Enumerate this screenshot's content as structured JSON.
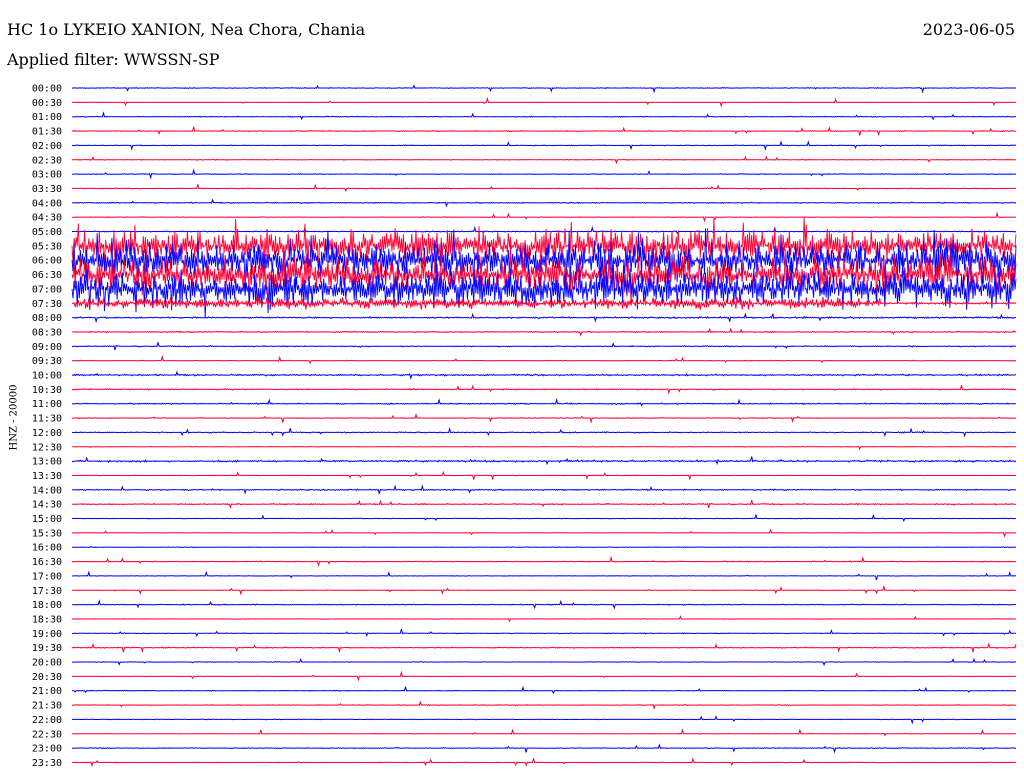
{
  "header": {
    "station": "HC 1o LYKEIO XANION, Nea Chora, Chania",
    "date": "2023-06-05",
    "filter": "Applied filter: WWSSN-SP"
  },
  "chart_data": {
    "type": "helicorder",
    "title": "HC 1o LYKEIO XANION, Nea Chora, Chania",
    "subtitle": "Applied filter: WWSSN-SP",
    "ylabel": "HNZ - 20000",
    "date": "2023-06-05",
    "colors": [
      "#0000ff",
      "#ff0033"
    ],
    "rows": [
      {
        "label": "00:00",
        "color": "#0000ff",
        "activity": 0.05
      },
      {
        "label": "00:30",
        "color": "#ff0033",
        "activity": 0.03
      },
      {
        "label": "01:00",
        "color": "#0000ff",
        "activity": 0.06
      },
      {
        "label": "01:30",
        "color": "#ff0033",
        "activity": 0.06
      },
      {
        "label": "02:00",
        "color": "#0000ff",
        "activity": 0.05
      },
      {
        "label": "02:30",
        "color": "#ff0033",
        "activity": 0.05
      },
      {
        "label": "03:00",
        "color": "#0000ff",
        "activity": 0.05
      },
      {
        "label": "03:30",
        "color": "#ff0033",
        "activity": 0.06
      },
      {
        "label": "04:00",
        "color": "#0000ff",
        "activity": 0.07
      },
      {
        "label": "04:30",
        "color": "#ff0033",
        "activity": 0.05
      },
      {
        "label": "05:00",
        "color": "#0000ff",
        "activity": 0.06
      },
      {
        "label": "05:30",
        "color": "#ff0033",
        "activity": 0.9
      },
      {
        "label": "06:00",
        "color": "#0000ff",
        "activity": 1.0
      },
      {
        "label": "06:30",
        "color": "#ff0033",
        "activity": 1.0
      },
      {
        "label": "07:00",
        "color": "#0000ff",
        "activity": 1.0
      },
      {
        "label": "07:30",
        "color": "#ff0033",
        "activity": 0.3
      },
      {
        "label": "08:00",
        "color": "#0000ff",
        "activity": 0.1
      },
      {
        "label": "08:30",
        "color": "#ff0033",
        "activity": 0.08
      },
      {
        "label": "09:00",
        "color": "#0000ff",
        "activity": 0.07
      },
      {
        "label": "09:30",
        "color": "#ff0033",
        "activity": 0.05
      },
      {
        "label": "10:00",
        "color": "#0000ff",
        "activity": 0.1
      },
      {
        "label": "10:30",
        "color": "#ff0033",
        "activity": 0.08
      },
      {
        "label": "11:00",
        "color": "#0000ff",
        "activity": 0.08
      },
      {
        "label": "11:30",
        "color": "#ff0033",
        "activity": 0.05
      },
      {
        "label": "12:00",
        "color": "#0000ff",
        "activity": 0.07
      },
      {
        "label": "12:30",
        "color": "#ff0033",
        "activity": 0.04
      },
      {
        "label": "13:00",
        "color": "#0000ff",
        "activity": 0.12
      },
      {
        "label": "13:30",
        "color": "#ff0033",
        "activity": 0.04
      },
      {
        "label": "14:00",
        "color": "#0000ff",
        "activity": 0.08
      },
      {
        "label": "14:30",
        "color": "#ff0033",
        "activity": 0.08
      },
      {
        "label": "15:00",
        "color": "#0000ff",
        "activity": 0.04
      },
      {
        "label": "15:30",
        "color": "#ff0033",
        "activity": 0.03
      },
      {
        "label": "16:00",
        "color": "#0000ff",
        "activity": 0.04
      },
      {
        "label": "16:30",
        "color": "#ff0033",
        "activity": 0.06
      },
      {
        "label": "17:00",
        "color": "#0000ff",
        "activity": 0.03
      },
      {
        "label": "17:30",
        "color": "#ff0033",
        "activity": 0.04
      },
      {
        "label": "18:00",
        "color": "#0000ff",
        "activity": 0.06
      },
      {
        "label": "18:30",
        "color": "#ff0033",
        "activity": 0.04
      },
      {
        "label": "19:00",
        "color": "#0000ff",
        "activity": 0.05
      },
      {
        "label": "19:30",
        "color": "#ff0033",
        "activity": 0.07
      },
      {
        "label": "20:00",
        "color": "#0000ff",
        "activity": 0.04
      },
      {
        "label": "20:30",
        "color": "#ff0033",
        "activity": 0.03
      },
      {
        "label": "21:00",
        "color": "#0000ff",
        "activity": 0.05
      },
      {
        "label": "21:30",
        "color": "#ff0033",
        "activity": 0.05
      },
      {
        "label": "22:00",
        "color": "#0000ff",
        "activity": 0.04
      },
      {
        "label": "22:30",
        "color": "#ff0033",
        "activity": 0.04
      },
      {
        "label": "23:00",
        "color": "#0000ff",
        "activity": 0.05
      },
      {
        "label": "23:30",
        "color": "#ff0033",
        "activity": 0.04
      }
    ],
    "grid": false
  }
}
